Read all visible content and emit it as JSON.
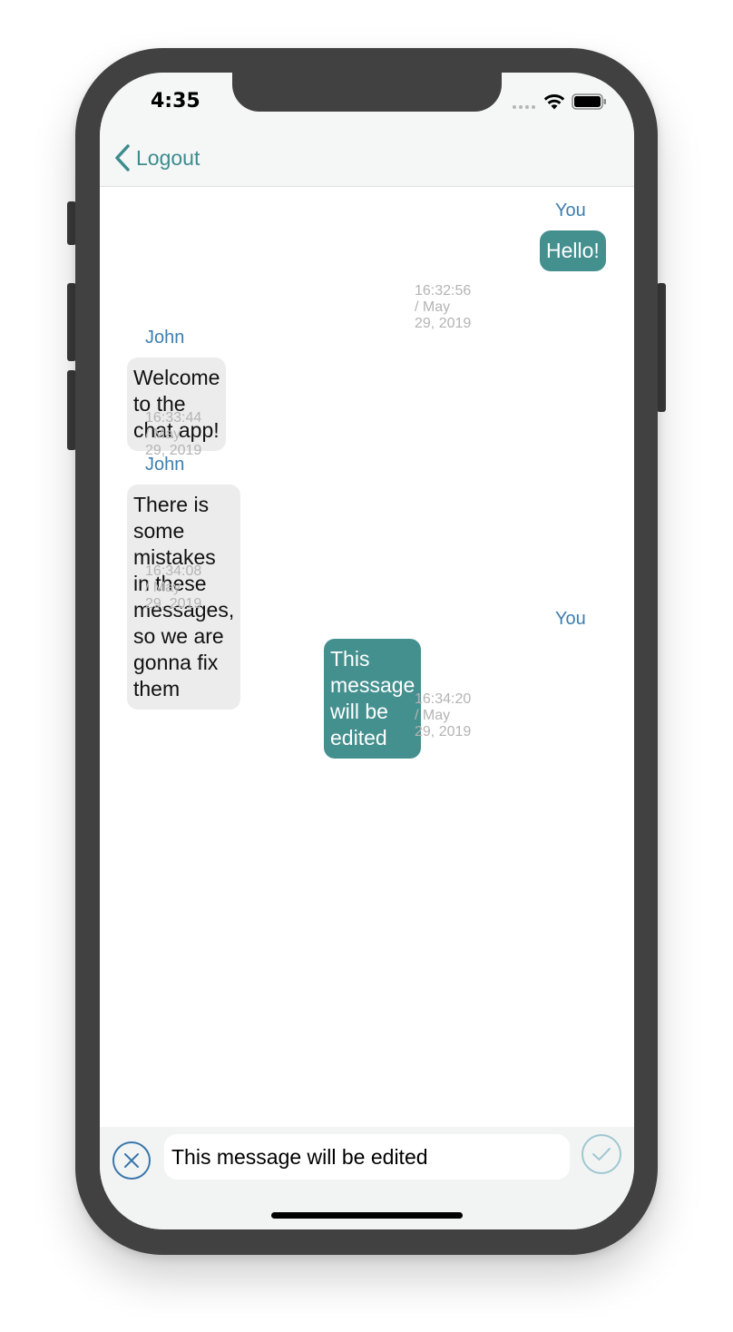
{
  "status_bar": {
    "time": "4:35"
  },
  "nav": {
    "back_label": "Logout"
  },
  "messages": [
    {
      "sender": "You",
      "text_lines": [
        "Hello!"
      ],
      "timestamp": "16:32:56 / May 29, 2019",
      "outgoing": true
    },
    {
      "sender": "John",
      "text_lines": [
        "Welcome to the chat app!"
      ],
      "timestamp": "16:33:44 / May 29, 2019",
      "outgoing": false
    },
    {
      "sender": "John",
      "text_lines": [
        "There is some mistakes in these",
        "messages, so we are gonna fix them"
      ],
      "timestamp": "16:34:08 / May 29, 2019",
      "outgoing": false
    },
    {
      "sender": "You",
      "text_lines": [
        "This message will be edited"
      ],
      "timestamp": "16:34:20 / May 29, 2019",
      "outgoing": true
    }
  ],
  "composer": {
    "value": "This message will be edited"
  },
  "colors": {
    "accent": "#3d8c8e",
    "outgoing_bubble": "#44908f",
    "incoming_bubble": "#ececec",
    "sender_name": "#3c7fae",
    "timestamp": "#b4b4b4"
  },
  "icons": {
    "back": "chevron-left-icon",
    "cancel": "close-circle-icon",
    "confirm": "checkmark-circle-icon",
    "wifi": "wifi-icon",
    "battery": "battery-icon"
  }
}
